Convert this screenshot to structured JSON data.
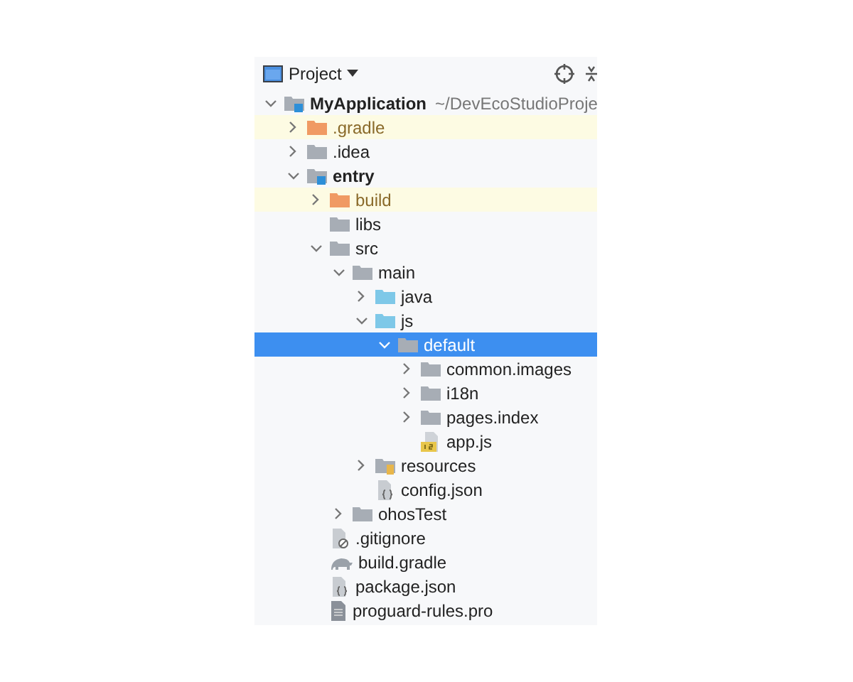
{
  "header": {
    "title": "Project"
  },
  "tree": [
    {
      "label": "MyApplication",
      "detail": "~/DevEcoStudioProje",
      "kind": "module",
      "bold": true,
      "expanded": true,
      "selected": false,
      "highlighted": false,
      "children": [
        {
          "label": ".gradle",
          "kind": "folder-orange",
          "bold": false,
          "expanded": false,
          "selected": false,
          "highlighted": true
        },
        {
          "label": ".idea",
          "kind": "folder",
          "bold": false,
          "expanded": false,
          "selected": false,
          "highlighted": false
        },
        {
          "label": "entry",
          "kind": "module",
          "bold": true,
          "expanded": true,
          "selected": false,
          "highlighted": false,
          "children": [
            {
              "label": "build",
              "kind": "folder-orange",
              "bold": false,
              "expanded": false,
              "selected": false,
              "highlighted": true
            },
            {
              "label": "libs",
              "kind": "folder",
              "bold": false,
              "selected": false,
              "highlighted": false
            },
            {
              "label": "src",
              "kind": "folder",
              "bold": false,
              "expanded": true,
              "selected": false,
              "highlighted": false,
              "children": [
                {
                  "label": "main",
                  "kind": "folder",
                  "bold": false,
                  "expanded": true,
                  "selected": false,
                  "highlighted": false,
                  "children": [
                    {
                      "label": "java",
                      "kind": "folder-blue",
                      "bold": false,
                      "expanded": false,
                      "selected": false,
                      "highlighted": false
                    },
                    {
                      "label": "js",
                      "kind": "folder-blue",
                      "bold": false,
                      "expanded": true,
                      "selected": false,
                      "highlighted": false,
                      "children": [
                        {
                          "label": "default",
                          "kind": "folder",
                          "bold": false,
                          "expanded": true,
                          "selected": true,
                          "highlighted": false,
                          "children": [
                            {
                              "label": "common.images",
                              "kind": "folder",
                              "bold": false,
                              "expanded": false,
                              "selected": false,
                              "highlighted": false
                            },
                            {
                              "label": "i18n",
                              "kind": "folder",
                              "bold": false,
                              "expanded": false,
                              "selected": false,
                              "highlighted": false
                            },
                            {
                              "label": "pages.index",
                              "kind": "folder",
                              "bold": false,
                              "expanded": false,
                              "selected": false,
                              "highlighted": false
                            },
                            {
                              "label": "app.js",
                              "kind": "file-js",
                              "bold": false,
                              "selected": false,
                              "highlighted": false
                            }
                          ]
                        }
                      ]
                    },
                    {
                      "label": "resources",
                      "kind": "resources",
                      "bold": false,
                      "expanded": false,
                      "selected": false,
                      "highlighted": false
                    },
                    {
                      "label": "config.json",
                      "kind": "file-json",
                      "bold": false,
                      "selected": false,
                      "highlighted": false
                    }
                  ]
                },
                {
                  "label": "ohosTest",
                  "kind": "folder",
                  "bold": false,
                  "expanded": false,
                  "selected": false,
                  "highlighted": false
                }
              ]
            },
            {
              "label": ".gitignore",
              "kind": "file-ignore",
              "bold": false,
              "selected": false,
              "highlighted": false
            },
            {
              "label": "build.gradle",
              "kind": "file-gradle",
              "bold": false,
              "selected": false,
              "highlighted": false
            },
            {
              "label": "package.json",
              "kind": "file-json",
              "bold": false,
              "selected": false,
              "highlighted": false
            },
            {
              "label": "proguard-rules.pro",
              "kind": "file",
              "bold": false,
              "selected": false,
              "highlighted": false
            }
          ]
        }
      ]
    }
  ]
}
